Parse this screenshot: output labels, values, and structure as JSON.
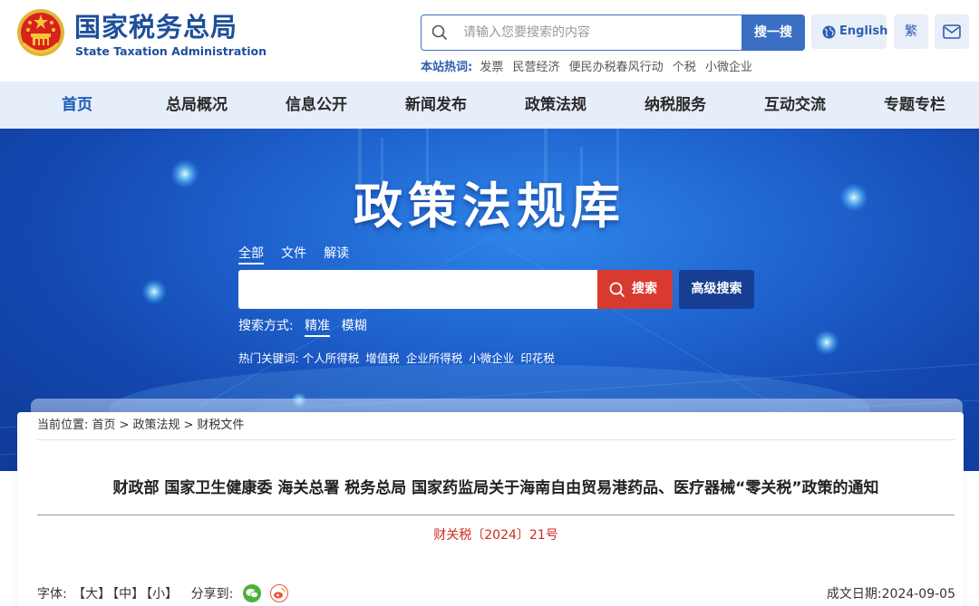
{
  "header": {
    "logo_cn": "国家税务总局",
    "logo_en": "State Taxation Administration",
    "search_placeholder": "请输入您要搜索的内容",
    "search_button": "搜一搜",
    "hot_label": "本站热词:",
    "hot_words": [
      "发票",
      "民营经济",
      "便民办税春风行动",
      "个税",
      "小微企业"
    ],
    "english_label": "English",
    "traditional_label": "繁"
  },
  "nav": {
    "items": [
      "首页",
      "总局概况",
      "信息公开",
      "新闻发布",
      "政策法规",
      "纳税服务",
      "互动交流",
      "专题专栏"
    ],
    "active_index": 0
  },
  "banner": {
    "title": "政策法规库",
    "tabs": [
      "全部",
      "文件",
      "解读"
    ],
    "search_button": "搜索",
    "advanced_button": "高级搜索",
    "mode_label": "搜索方式:",
    "modes": [
      "精准",
      "模糊"
    ],
    "keywords_label": "热门关键词:",
    "keywords": [
      "个人所得税",
      "增值税",
      "企业所得税",
      "小微企业",
      "印花税"
    ]
  },
  "breadcrumb": {
    "label": "当前位置:",
    "items": [
      "首页",
      "政策法规",
      "财税文件"
    ]
  },
  "document": {
    "title": "财政部 国家卫生健康委 海关总署 税务总局 国家药监局关于海南自由贸易港药品、医疗器械“零关税”政策的通知",
    "number": "财关税〔2024〕21号",
    "font_label": "字体:",
    "font_sizes": [
      "【大】",
      "【中】",
      "【小】"
    ],
    "share_label": "分享到:",
    "date_label": "成文日期:",
    "date_value": "2024-09-05"
  },
  "colors": {
    "brand": "#1d4f9c",
    "nav_bg": "#e6eef9",
    "search_red": "#d93a2f",
    "doc_number_red": "#d02a1f"
  }
}
